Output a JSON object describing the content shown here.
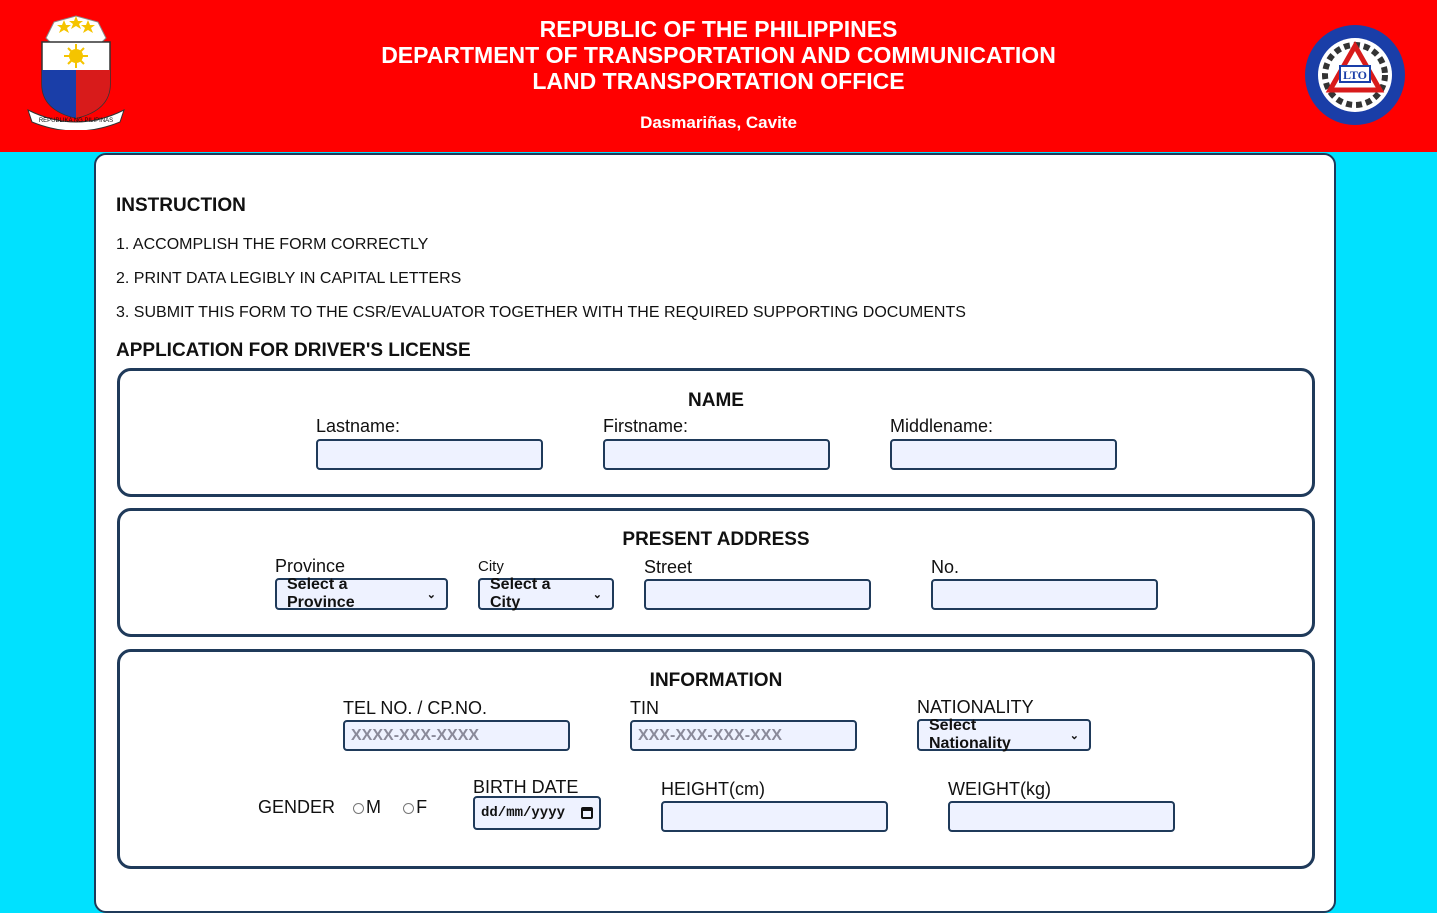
{
  "header": {
    "line1": "REPUBLIC OF THE PHILIPPINES",
    "line2": "DEPARTMENT OF TRANSPORTATION AND COMMUNICATION",
    "line3": "LAND TRANSPORTATION OFFICE",
    "location": "Dasmariñas, Cavite",
    "seal_text": "REPUBLIKA NG PILIPINAS",
    "lto_text": "LTO"
  },
  "instructions": {
    "title": "INSTRUCTION",
    "items": [
      "1. ACCOMPLISH THE FORM CORRECTLY",
      "2. PRINT DATA LEGIBLY IN CAPITAL LETTERS",
      "3. SUBMIT THIS FORM TO THE CSR/EVALUATOR TOGETHER WITH THE REQUIRED SUPPORTING DOCUMENTS"
    ]
  },
  "form_title": "APPLICATION FOR DRIVER'S LICENSE",
  "name": {
    "title": "NAME",
    "lastname_label": "Lastname:",
    "firstname_label": "Firstname:",
    "middlename_label": "Middlename:"
  },
  "address": {
    "title": "PRESENT ADDRESS",
    "province_label": "Province",
    "province_value": "Select a Province",
    "city_label": "City",
    "city_value": "Select a City",
    "street_label": "Street",
    "no_label": "No."
  },
  "information": {
    "title": "INFORMATION",
    "tel_label": "TEL NO. / CP.NO.",
    "tel_placeholder": "XXXX-XXX-XXXX",
    "tin_label": "TIN",
    "tin_placeholder": "XXX-XXX-XXX-XXX",
    "nationality_label": "NATIONALITY",
    "nationality_value": "Select Nationality",
    "gender_label": "GENDER",
    "gender_m": "M",
    "gender_f": "F",
    "birthdate_label": "BIRTH DATE",
    "birthdate_value": "dd/mm/yyyy",
    "height_label": "HEIGHT(cm)",
    "weight_label": "WEIGHT(kg)"
  },
  "colors": {
    "header_bg": "#ff0000",
    "page_bg": "#00e1ff",
    "border": "#1f3a5a",
    "input_bg": "#eef2ff"
  }
}
